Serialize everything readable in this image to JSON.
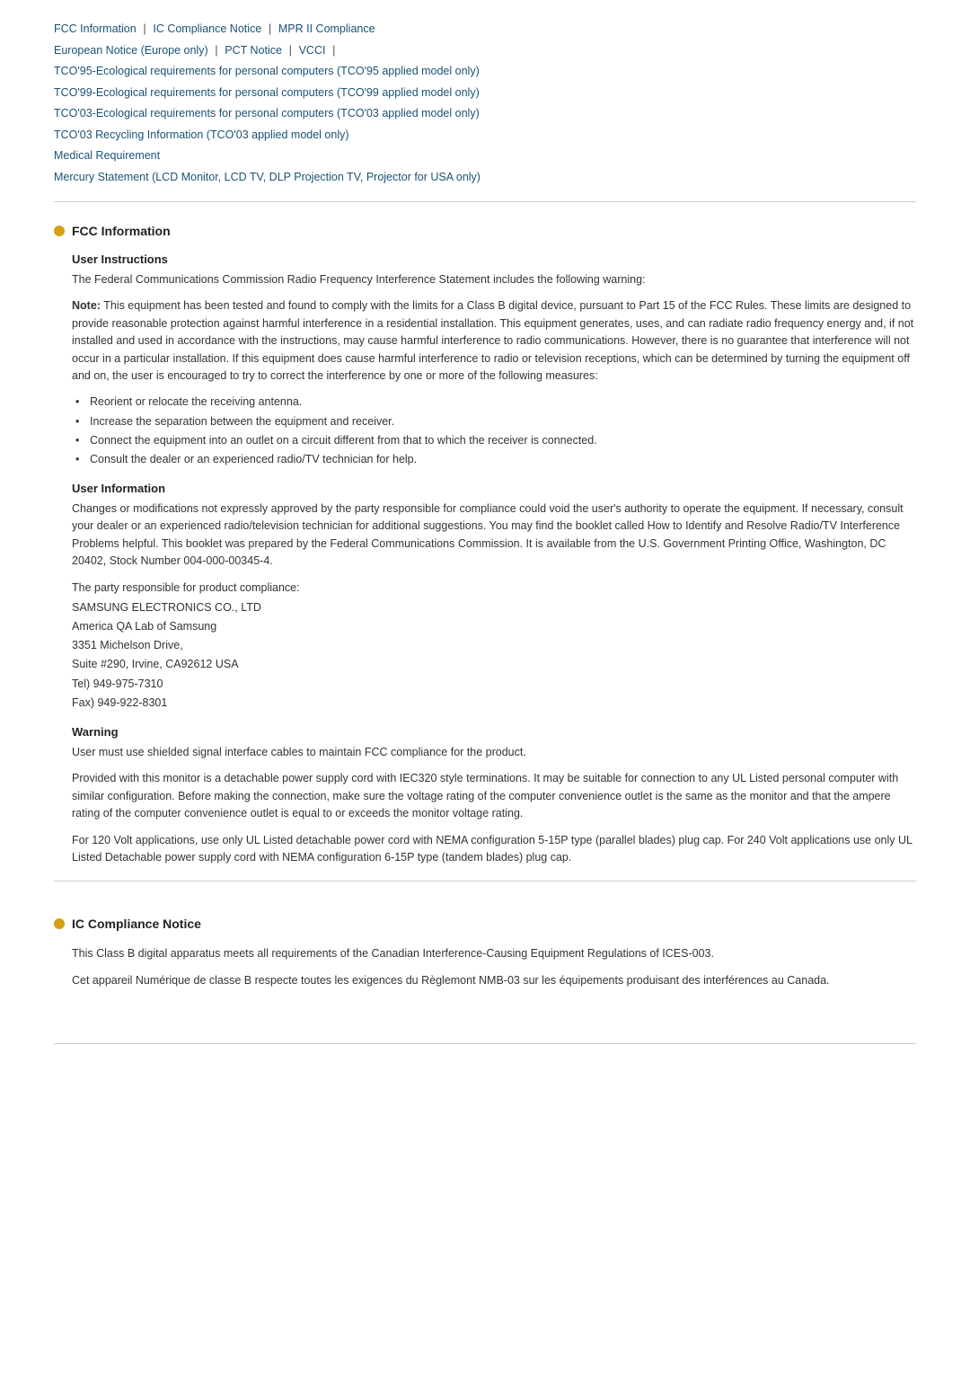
{
  "nav": {
    "links": [
      {
        "label": "FCC Information",
        "id": "fcc"
      },
      {
        "label": "IC Compliance Notice",
        "id": "ic"
      },
      {
        "label": "MPR II Compliance",
        "id": "mpr"
      },
      {
        "label": "European Notice (Europe only)",
        "id": "eu"
      },
      {
        "label": "PCT Notice",
        "id": "pct"
      },
      {
        "label": "VCCI",
        "id": "vcci"
      },
      {
        "label": "TCO'95-Ecological requirements for personal computers (TCO'95 applied model only)",
        "id": "tco95"
      },
      {
        "label": "TCO'99-Ecological requirements for personal computers (TCO'99 applied model only)",
        "id": "tco99"
      },
      {
        "label": "TCO'03-Ecological requirements for personal computers (TCO'03 applied model only)",
        "id": "tco03"
      },
      {
        "label": "TCO'03 Recycling Information (TCO'03 applied model only)",
        "id": "tco03r"
      },
      {
        "label": "Medical Requirement",
        "id": "medical"
      },
      {
        "label": "Mercury Statement (LCD Monitor, LCD TV, DLP Projection TV, Projector for USA only)",
        "id": "mercury"
      }
    ]
  },
  "sections": {
    "fcc": {
      "title": "FCC Information",
      "subsections": {
        "user_instructions": {
          "title": "User Instructions",
          "intro": "The Federal Communications Commission Radio Frequency Interference Statement includes the following warning:",
          "note_label": "Note:",
          "note_text": " This equipment has been tested and found to comply with the limits for a Class B digital device, pursuant to Part 15 of the FCC Rules. These limits are designed to provide reasonable protection against harmful interference in a residential installation. This equipment generates, uses, and can radiate radio frequency energy and, if not installed and used in accordance with the instructions, may cause harmful interference to radio communications. However, there is no guarantee that interference will not occur in a particular installation. If this equipment does cause harmful interference to radio or television receptions, which can be determined by turning the equipment off and on, the user is encouraged to try to correct the interference by one or more of the following measures:",
          "bullets": [
            "Reorient or relocate the receiving antenna.",
            "Increase the separation between the equipment and receiver.",
            "Connect the equipment into an outlet on a circuit different from that to which the receiver is connected.",
            "Consult the dealer or an experienced radio/TV technician for help."
          ]
        },
        "user_information": {
          "title": "User Information",
          "text": "Changes or modifications not expressly approved by the party responsible for compliance could void the user's authority to operate the equipment. If necessary, consult your dealer or an experienced radio/television technician for additional suggestions. You may find the booklet called How to Identify and Resolve Radio/TV Interference Problems helpful. This booklet was prepared by the Federal Communications Commission. It is available from the U.S. Government Printing Office, Washington, DC 20402, Stock Number 004-000-00345-4.",
          "contact_intro": "The party responsible for product compliance:",
          "contact_lines": [
            "SAMSUNG ELECTRONICS CO., LTD",
            "America QA Lab of Samsung",
            "3351 Michelson Drive,",
            "Suite #290, Irvine, CA92612 USA",
            "Tel) 949-975-7310",
            "Fax) 949-922-8301"
          ]
        },
        "warning": {
          "title": "Warning",
          "text1": "User must use shielded signal interface cables to maintain FCC compliance for the product.",
          "text2": "Provided with this monitor is a detachable power supply cord with IEC320 style terminations. It may be suitable for connection to any UL Listed personal computer with similar configuration. Before making the connection, make sure the voltage rating of the computer convenience outlet is the same as the monitor and that the ampere rating of the computer convenience outlet is equal to or exceeds the monitor voltage rating.",
          "text3": "For 120 Volt applications, use only UL Listed detachable power cord with NEMA configuration 5-15P type (parallel blades) plug cap. For 240 Volt applications use only UL Listed Detachable power supply cord with NEMA configuration 6-15P type (tandem blades) plug cap."
        }
      }
    },
    "ic": {
      "title": "IC Compliance Notice",
      "para1": "This Class B digital apparatus meets all requirements of the Canadian Interference-Causing Equipment Regulations of ICES-003.",
      "para2": "Cet appareil Numérique de classe B respecte toutes les exigences du Règlemont NMB-03 sur les équipements produisant des interférences au Canada."
    }
  }
}
